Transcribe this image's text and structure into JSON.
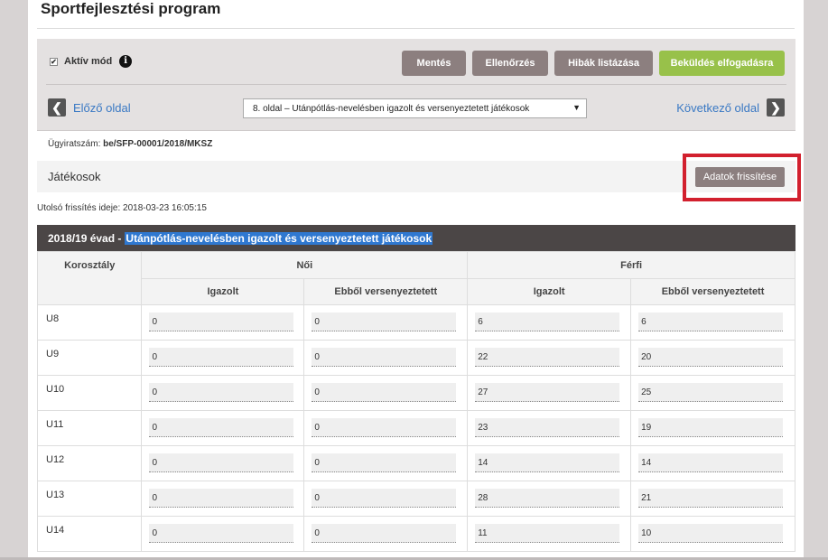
{
  "page_title": "Sportfejlesztési program",
  "toolbar": {
    "aktiv_mode_label": "Aktív mód",
    "aktiv_checked": "✔",
    "info_icon": "i",
    "buttons": {
      "save": "Mentés",
      "check": "Ellenőrzés",
      "list_errors": "Hibák listázása",
      "submit": "Beküldés elfogadásra"
    }
  },
  "nav": {
    "prev_label": "Előző oldal",
    "next_label": "Következő oldal",
    "prev_arrow": "❮",
    "next_arrow": "❯",
    "page_select_value": "8. oldal – Utánpótlás-nevelésben igazolt és versenyeztetett játékosok",
    "caret": "▼"
  },
  "case_number_label": "Ügyiratszám:",
  "case_number": "be/SFP-00001/2018/MKSZ",
  "section": {
    "title": "Játékosok",
    "refresh_button": "Adatok frissítése"
  },
  "last_refresh": "Utolsó frissítés ideje: 2018-03-23 16:05:15",
  "season": {
    "prefix": "2018/19 évad -",
    "highlighted": "Utánpótlás-nevelésben igazolt és versenyeztetett játékosok"
  },
  "table": {
    "headers": {
      "age_class": "Korosztály",
      "female": "Női",
      "male": "Férfi",
      "registered": "Igazolt",
      "competing": "Ebből versenyeztetett"
    },
    "rows": [
      {
        "age": "U8",
        "f_reg": "0",
        "f_comp": "0",
        "m_reg": "6",
        "m_comp": "6"
      },
      {
        "age": "U9",
        "f_reg": "0",
        "f_comp": "0",
        "m_reg": "22",
        "m_comp": "20"
      },
      {
        "age": "U10",
        "f_reg": "0",
        "f_comp": "0",
        "m_reg": "27",
        "m_comp": "25"
      },
      {
        "age": "U11",
        "f_reg": "0",
        "f_comp": "0",
        "m_reg": "23",
        "m_comp": "19"
      },
      {
        "age": "U12",
        "f_reg": "0",
        "f_comp": "0",
        "m_reg": "14",
        "m_comp": "14"
      },
      {
        "age": "U13",
        "f_reg": "0",
        "f_comp": "0",
        "m_reg": "28",
        "m_comp": "21"
      },
      {
        "age": "U14",
        "f_reg": "0",
        "f_comp": "0",
        "m_reg": "11",
        "m_comp": "10"
      }
    ]
  },
  "colors": {
    "accent_green": "#98c14a",
    "button_gray": "#8c7f7f",
    "highlight_red": "#d2202e",
    "link_blue": "#3a79c4"
  }
}
